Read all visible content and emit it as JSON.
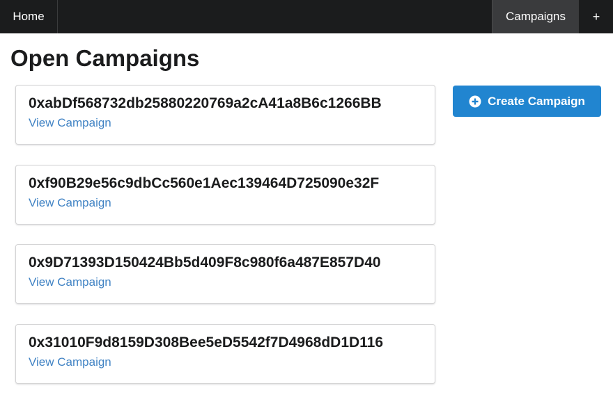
{
  "nav": {
    "home_label": "Home",
    "campaigns_label": "Campaigns",
    "add_label": "+"
  },
  "page": {
    "title": "Open Campaigns"
  },
  "campaigns": [
    {
      "address": "0xabDf568732db25880220769a2cA41a8B6c1266BB",
      "link_label": "View Campaign"
    },
    {
      "address": "0xf90B29e56c9dbCc560e1Aec139464D725090e32F",
      "link_label": "View Campaign"
    },
    {
      "address": "0x9D71393D150424Bb5d409F8c980f6a487E857D40",
      "link_label": "View Campaign"
    },
    {
      "address": "0x31010F9d8159D308Bee5eD5542f7D4968dD1D116",
      "link_label": "View Campaign"
    }
  ],
  "create_button": {
    "label": "Create Campaign",
    "icon": "plus-circle-icon"
  },
  "colors": {
    "nav_background": "#1b1c1d",
    "nav_active": "#3a3b3d",
    "link": "#4183c4",
    "primary_button": "#2185d0"
  }
}
